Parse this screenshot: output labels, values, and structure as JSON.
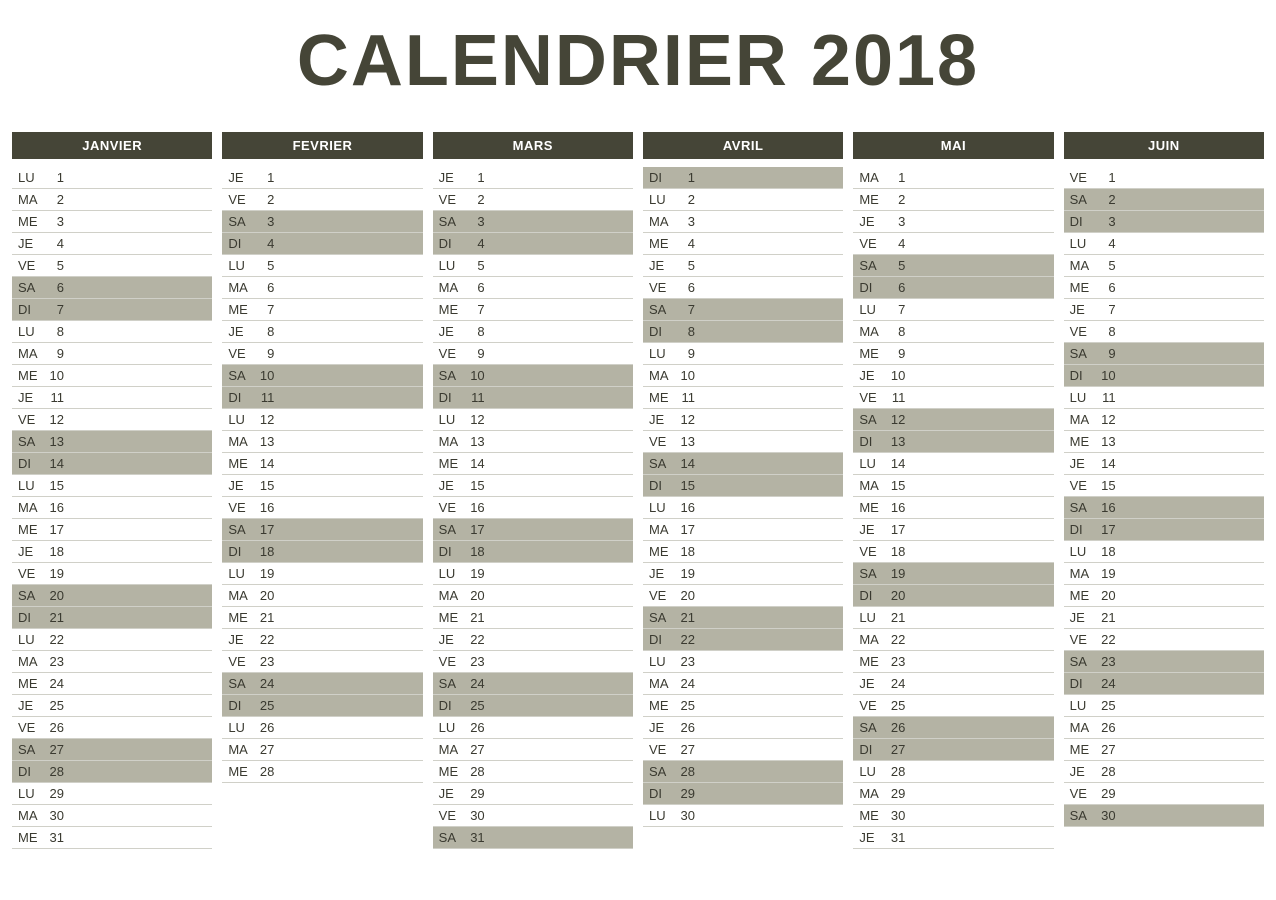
{
  "title": "CALENDRIER 2018",
  "dow_labels": [
    "LU",
    "MA",
    "ME",
    "JE",
    "VE",
    "SA",
    "DI"
  ],
  "weekend_dows": [
    "SA",
    "DI"
  ],
  "months": [
    {
      "name": "JANVIER",
      "days": [
        {
          "dow": "LU",
          "n": 1
        },
        {
          "dow": "MA",
          "n": 2
        },
        {
          "dow": "ME",
          "n": 3
        },
        {
          "dow": "JE",
          "n": 4
        },
        {
          "dow": "VE",
          "n": 5
        },
        {
          "dow": "SA",
          "n": 6
        },
        {
          "dow": "DI",
          "n": 7
        },
        {
          "dow": "LU",
          "n": 8
        },
        {
          "dow": "MA",
          "n": 9
        },
        {
          "dow": "ME",
          "n": 10
        },
        {
          "dow": "JE",
          "n": 11
        },
        {
          "dow": "VE",
          "n": 12
        },
        {
          "dow": "SA",
          "n": 13
        },
        {
          "dow": "DI",
          "n": 14
        },
        {
          "dow": "LU",
          "n": 15
        },
        {
          "dow": "MA",
          "n": 16
        },
        {
          "dow": "ME",
          "n": 17
        },
        {
          "dow": "JE",
          "n": 18
        },
        {
          "dow": "VE",
          "n": 19
        },
        {
          "dow": "SA",
          "n": 20
        },
        {
          "dow": "DI",
          "n": 21
        },
        {
          "dow": "LU",
          "n": 22
        },
        {
          "dow": "MA",
          "n": 23
        },
        {
          "dow": "ME",
          "n": 24
        },
        {
          "dow": "JE",
          "n": 25
        },
        {
          "dow": "VE",
          "n": 26
        },
        {
          "dow": "SA",
          "n": 27
        },
        {
          "dow": "DI",
          "n": 28
        },
        {
          "dow": "LU",
          "n": 29
        },
        {
          "dow": "MA",
          "n": 30
        },
        {
          "dow": "ME",
          "n": 31
        }
      ]
    },
    {
      "name": "FEVRIER",
      "days": [
        {
          "dow": "JE",
          "n": 1
        },
        {
          "dow": "VE",
          "n": 2
        },
        {
          "dow": "SA",
          "n": 3
        },
        {
          "dow": "DI",
          "n": 4
        },
        {
          "dow": "LU",
          "n": 5
        },
        {
          "dow": "MA",
          "n": 6
        },
        {
          "dow": "ME",
          "n": 7
        },
        {
          "dow": "JE",
          "n": 8
        },
        {
          "dow": "VE",
          "n": 9
        },
        {
          "dow": "SA",
          "n": 10
        },
        {
          "dow": "DI",
          "n": 11
        },
        {
          "dow": "LU",
          "n": 12
        },
        {
          "dow": "MA",
          "n": 13
        },
        {
          "dow": "ME",
          "n": 14
        },
        {
          "dow": "JE",
          "n": 15
        },
        {
          "dow": "VE",
          "n": 16
        },
        {
          "dow": "SA",
          "n": 17
        },
        {
          "dow": "DI",
          "n": 18
        },
        {
          "dow": "LU",
          "n": 19
        },
        {
          "dow": "MA",
          "n": 20
        },
        {
          "dow": "ME",
          "n": 21
        },
        {
          "dow": "JE",
          "n": 22
        },
        {
          "dow": "VE",
          "n": 23
        },
        {
          "dow": "SA",
          "n": 24
        },
        {
          "dow": "DI",
          "n": 25
        },
        {
          "dow": "LU",
          "n": 26
        },
        {
          "dow": "MA",
          "n": 27
        },
        {
          "dow": "ME",
          "n": 28
        }
      ]
    },
    {
      "name": "MARS",
      "days": [
        {
          "dow": "JE",
          "n": 1
        },
        {
          "dow": "VE",
          "n": 2
        },
        {
          "dow": "SA",
          "n": 3
        },
        {
          "dow": "DI",
          "n": 4
        },
        {
          "dow": "LU",
          "n": 5
        },
        {
          "dow": "MA",
          "n": 6
        },
        {
          "dow": "ME",
          "n": 7
        },
        {
          "dow": "JE",
          "n": 8
        },
        {
          "dow": "VE",
          "n": 9
        },
        {
          "dow": "SA",
          "n": 10
        },
        {
          "dow": "DI",
          "n": 11
        },
        {
          "dow": "LU",
          "n": 12
        },
        {
          "dow": "MA",
          "n": 13
        },
        {
          "dow": "ME",
          "n": 14
        },
        {
          "dow": "JE",
          "n": 15
        },
        {
          "dow": "VE",
          "n": 16
        },
        {
          "dow": "SA",
          "n": 17
        },
        {
          "dow": "DI",
          "n": 18
        },
        {
          "dow": "LU",
          "n": 19
        },
        {
          "dow": "MA",
          "n": 20
        },
        {
          "dow": "ME",
          "n": 21
        },
        {
          "dow": "JE",
          "n": 22
        },
        {
          "dow": "VE",
          "n": 23
        },
        {
          "dow": "SA",
          "n": 24
        },
        {
          "dow": "DI",
          "n": 25
        },
        {
          "dow": "LU",
          "n": 26
        },
        {
          "dow": "MA",
          "n": 27
        },
        {
          "dow": "ME",
          "n": 28
        },
        {
          "dow": "JE",
          "n": 29
        },
        {
          "dow": "VE",
          "n": 30
        },
        {
          "dow": "SA",
          "n": 31
        }
      ]
    },
    {
      "name": "AVRIL",
      "days": [
        {
          "dow": "DI",
          "n": 1
        },
        {
          "dow": "LU",
          "n": 2
        },
        {
          "dow": "MA",
          "n": 3
        },
        {
          "dow": "ME",
          "n": 4
        },
        {
          "dow": "JE",
          "n": 5
        },
        {
          "dow": "VE",
          "n": 6
        },
        {
          "dow": "SA",
          "n": 7
        },
        {
          "dow": "DI",
          "n": 8
        },
        {
          "dow": "LU",
          "n": 9
        },
        {
          "dow": "MA",
          "n": 10
        },
        {
          "dow": "ME",
          "n": 11
        },
        {
          "dow": "JE",
          "n": 12
        },
        {
          "dow": "VE",
          "n": 13
        },
        {
          "dow": "SA",
          "n": 14
        },
        {
          "dow": "DI",
          "n": 15
        },
        {
          "dow": "LU",
          "n": 16
        },
        {
          "dow": "MA",
          "n": 17
        },
        {
          "dow": "ME",
          "n": 18
        },
        {
          "dow": "JE",
          "n": 19
        },
        {
          "dow": "VE",
          "n": 20
        },
        {
          "dow": "SA",
          "n": 21
        },
        {
          "dow": "DI",
          "n": 22
        },
        {
          "dow": "LU",
          "n": 23
        },
        {
          "dow": "MA",
          "n": 24
        },
        {
          "dow": "ME",
          "n": 25
        },
        {
          "dow": "JE",
          "n": 26
        },
        {
          "dow": "VE",
          "n": 27
        },
        {
          "dow": "SA",
          "n": 28
        },
        {
          "dow": "DI",
          "n": 29
        },
        {
          "dow": "LU",
          "n": 30
        }
      ]
    },
    {
      "name": "MAI",
      "days": [
        {
          "dow": "MA",
          "n": 1
        },
        {
          "dow": "ME",
          "n": 2
        },
        {
          "dow": "JE",
          "n": 3
        },
        {
          "dow": "VE",
          "n": 4
        },
        {
          "dow": "SA",
          "n": 5
        },
        {
          "dow": "DI",
          "n": 6
        },
        {
          "dow": "LU",
          "n": 7
        },
        {
          "dow": "MA",
          "n": 8
        },
        {
          "dow": "ME",
          "n": 9
        },
        {
          "dow": "JE",
          "n": 10
        },
        {
          "dow": "VE",
          "n": 11
        },
        {
          "dow": "SA",
          "n": 12
        },
        {
          "dow": "DI",
          "n": 13
        },
        {
          "dow": "LU",
          "n": 14
        },
        {
          "dow": "MA",
          "n": 15
        },
        {
          "dow": "ME",
          "n": 16
        },
        {
          "dow": "JE",
          "n": 17
        },
        {
          "dow": "VE",
          "n": 18
        },
        {
          "dow": "SA",
          "n": 19
        },
        {
          "dow": "DI",
          "n": 20
        },
        {
          "dow": "LU",
          "n": 21
        },
        {
          "dow": "MA",
          "n": 22
        },
        {
          "dow": "ME",
          "n": 23
        },
        {
          "dow": "JE",
          "n": 24
        },
        {
          "dow": "VE",
          "n": 25
        },
        {
          "dow": "SA",
          "n": 26
        },
        {
          "dow": "DI",
          "n": 27
        },
        {
          "dow": "LU",
          "n": 28
        },
        {
          "dow": "MA",
          "n": 29
        },
        {
          "dow": "ME",
          "n": 30
        },
        {
          "dow": "JE",
          "n": 31
        }
      ]
    },
    {
      "name": "JUIN",
      "days": [
        {
          "dow": "VE",
          "n": 1
        },
        {
          "dow": "SA",
          "n": 2
        },
        {
          "dow": "DI",
          "n": 3
        },
        {
          "dow": "LU",
          "n": 4
        },
        {
          "dow": "MA",
          "n": 5
        },
        {
          "dow": "ME",
          "n": 6
        },
        {
          "dow": "JE",
          "n": 7
        },
        {
          "dow": "VE",
          "n": 8
        },
        {
          "dow": "SA",
          "n": 9
        },
        {
          "dow": "DI",
          "n": 10
        },
        {
          "dow": "LU",
          "n": 11
        },
        {
          "dow": "MA",
          "n": 12
        },
        {
          "dow": "ME",
          "n": 13
        },
        {
          "dow": "JE",
          "n": 14
        },
        {
          "dow": "VE",
          "n": 15
        },
        {
          "dow": "SA",
          "n": 16
        },
        {
          "dow": "DI",
          "n": 17
        },
        {
          "dow": "LU",
          "n": 18
        },
        {
          "dow": "MA",
          "n": 19
        },
        {
          "dow": "ME",
          "n": 20
        },
        {
          "dow": "JE",
          "n": 21
        },
        {
          "dow": "VE",
          "n": 22
        },
        {
          "dow": "SA",
          "n": 23
        },
        {
          "dow": "DI",
          "n": 24
        },
        {
          "dow": "LU",
          "n": 25
        },
        {
          "dow": "MA",
          "n": 26
        },
        {
          "dow": "ME",
          "n": 27
        },
        {
          "dow": "JE",
          "n": 28
        },
        {
          "dow": "VE",
          "n": 29
        },
        {
          "dow": "SA",
          "n": 30
        }
      ]
    }
  ]
}
